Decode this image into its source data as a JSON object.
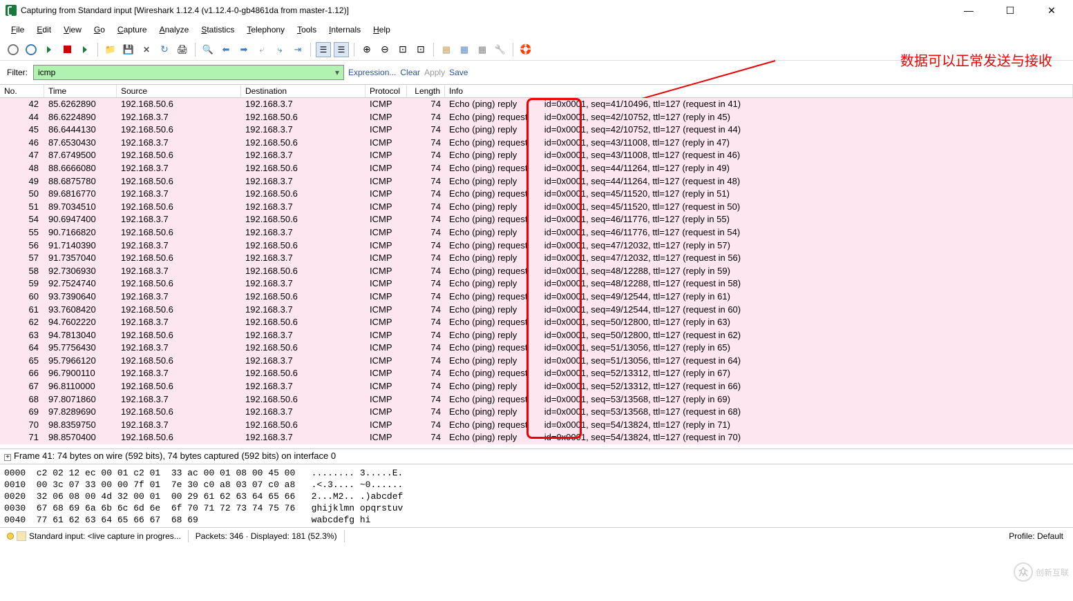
{
  "title": "Capturing from Standard input   [Wireshark 1.12.4  (v1.12.4-0-gb4861da from master-1.12)]",
  "menus": [
    "File",
    "Edit",
    "View",
    "Go",
    "Capture",
    "Analyze",
    "Statistics",
    "Telephony",
    "Tools",
    "Internals",
    "Help"
  ],
  "filter": {
    "label": "Filter:",
    "value": "icmp",
    "links": [
      "Expression...",
      "Clear",
      "Apply",
      "Save"
    ]
  },
  "columns": [
    "No.",
    "Time",
    "Source",
    "Destination",
    "Protocol",
    "Length",
    "Info"
  ],
  "packets": [
    {
      "no": 42,
      "time": "85.6262890",
      "src": "192.168.50.6",
      "dst": "192.168.3.7",
      "proto": "ICMP",
      "len": 74,
      "prefix": "Echo (ping)",
      "type": "reply",
      "rest": "id=0x0001, seq=41/10496, ttl=127 (request in 41)"
    },
    {
      "no": 44,
      "time": "86.6224890",
      "src": "192.168.3.7",
      "dst": "192.168.50.6",
      "proto": "ICMP",
      "len": 74,
      "prefix": "Echo (ping)",
      "type": "request",
      "rest": "id=0x0001, seq=42/10752, ttl=127 (reply in 45)"
    },
    {
      "no": 45,
      "time": "86.6444130",
      "src": "192.168.50.6",
      "dst": "192.168.3.7",
      "proto": "ICMP",
      "len": 74,
      "prefix": "Echo (ping)",
      "type": "reply",
      "rest": "id=0x0001, seq=42/10752, ttl=127 (request in 44)"
    },
    {
      "no": 46,
      "time": "87.6530430",
      "src": "192.168.3.7",
      "dst": "192.168.50.6",
      "proto": "ICMP",
      "len": 74,
      "prefix": "Echo (ping)",
      "type": "request",
      "rest": "id=0x0001, seq=43/11008, ttl=127 (reply in 47)"
    },
    {
      "no": 47,
      "time": "87.6749500",
      "src": "192.168.50.6",
      "dst": "192.168.3.7",
      "proto": "ICMP",
      "len": 74,
      "prefix": "Echo (ping)",
      "type": "reply",
      "rest": "id=0x0001, seq=43/11008, ttl=127 (request in 46)"
    },
    {
      "no": 48,
      "time": "88.6666080",
      "src": "192.168.3.7",
      "dst": "192.168.50.6",
      "proto": "ICMP",
      "len": 74,
      "prefix": "Echo (ping)",
      "type": "request",
      "rest": "id=0x0001, seq=44/11264, ttl=127 (reply in 49)"
    },
    {
      "no": 49,
      "time": "88.6875780",
      "src": "192.168.50.6",
      "dst": "192.168.3.7",
      "proto": "ICMP",
      "len": 74,
      "prefix": "Echo (ping)",
      "type": "reply",
      "rest": "id=0x0001, seq=44/11264, ttl=127 (request in 48)"
    },
    {
      "no": 50,
      "time": "89.6816770",
      "src": "192.168.3.7",
      "dst": "192.168.50.6",
      "proto": "ICMP",
      "len": 74,
      "prefix": "Echo (ping)",
      "type": "request",
      "rest": "id=0x0001, seq=45/11520, ttl=127 (reply in 51)"
    },
    {
      "no": 51,
      "time": "89.7034510",
      "src": "192.168.50.6",
      "dst": "192.168.3.7",
      "proto": "ICMP",
      "len": 74,
      "prefix": "Echo (ping)",
      "type": "reply",
      "rest": "id=0x0001, seq=45/11520, ttl=127 (request in 50)"
    },
    {
      "no": 54,
      "time": "90.6947400",
      "src": "192.168.3.7",
      "dst": "192.168.50.6",
      "proto": "ICMP",
      "len": 74,
      "prefix": "Echo (ping)",
      "type": "request",
      "rest": "id=0x0001, seq=46/11776, ttl=127 (reply in 55)"
    },
    {
      "no": 55,
      "time": "90.7166820",
      "src": "192.168.50.6",
      "dst": "192.168.3.7",
      "proto": "ICMP",
      "len": 74,
      "prefix": "Echo (ping)",
      "type": "reply",
      "rest": "id=0x0001, seq=46/11776, ttl=127 (request in 54)"
    },
    {
      "no": 56,
      "time": "91.7140390",
      "src": "192.168.3.7",
      "dst": "192.168.50.6",
      "proto": "ICMP",
      "len": 74,
      "prefix": "Echo (ping)",
      "type": "request",
      "rest": "id=0x0001, seq=47/12032, ttl=127 (reply in 57)"
    },
    {
      "no": 57,
      "time": "91.7357040",
      "src": "192.168.50.6",
      "dst": "192.168.3.7",
      "proto": "ICMP",
      "len": 74,
      "prefix": "Echo (ping)",
      "type": "reply",
      "rest": "id=0x0001, seq=47/12032, ttl=127 (request in 56)"
    },
    {
      "no": 58,
      "time": "92.7306930",
      "src": "192.168.3.7",
      "dst": "192.168.50.6",
      "proto": "ICMP",
      "len": 74,
      "prefix": "Echo (ping)",
      "type": "request",
      "rest": "id=0x0001, seq=48/12288, ttl=127 (reply in 59)"
    },
    {
      "no": 59,
      "time": "92.7524740",
      "src": "192.168.50.6",
      "dst": "192.168.3.7",
      "proto": "ICMP",
      "len": 74,
      "prefix": "Echo (ping)",
      "type": "reply",
      "rest": "id=0x0001, seq=48/12288, ttl=127 (request in 58)"
    },
    {
      "no": 60,
      "time": "93.7390640",
      "src": "192.168.3.7",
      "dst": "192.168.50.6",
      "proto": "ICMP",
      "len": 74,
      "prefix": "Echo (ping)",
      "type": "request",
      "rest": "id=0x0001, seq=49/12544, ttl=127 (reply in 61)"
    },
    {
      "no": 61,
      "time": "93.7608420",
      "src": "192.168.50.6",
      "dst": "192.168.3.7",
      "proto": "ICMP",
      "len": 74,
      "prefix": "Echo (ping)",
      "type": "reply",
      "rest": "id=0x0001, seq=49/12544, ttl=127 (request in 60)"
    },
    {
      "no": 62,
      "time": "94.7602220",
      "src": "192.168.3.7",
      "dst": "192.168.50.6",
      "proto": "ICMP",
      "len": 74,
      "prefix": "Echo (ping)",
      "type": "request",
      "rest": "id=0x0001, seq=50/12800, ttl=127 (reply in 63)"
    },
    {
      "no": 63,
      "time": "94.7813040",
      "src": "192.168.50.6",
      "dst": "192.168.3.7",
      "proto": "ICMP",
      "len": 74,
      "prefix": "Echo (ping)",
      "type": "reply",
      "rest": "id=0x0001, seq=50/12800, ttl=127 (request in 62)"
    },
    {
      "no": 64,
      "time": "95.7756430",
      "src": "192.168.3.7",
      "dst": "192.168.50.6",
      "proto": "ICMP",
      "len": 74,
      "prefix": "Echo (ping)",
      "type": "request",
      "rest": "id=0x0001, seq=51/13056, ttl=127 (reply in 65)"
    },
    {
      "no": 65,
      "time": "95.7966120",
      "src": "192.168.50.6",
      "dst": "192.168.3.7",
      "proto": "ICMP",
      "len": 74,
      "prefix": "Echo (ping)",
      "type": "reply",
      "rest": "id=0x0001, seq=51/13056, ttl=127 (request in 64)"
    },
    {
      "no": 66,
      "time": "96.7900110",
      "src": "192.168.3.7",
      "dst": "192.168.50.6",
      "proto": "ICMP",
      "len": 74,
      "prefix": "Echo (ping)",
      "type": "request",
      "rest": "id=0x0001, seq=52/13312, ttl=127 (reply in 67)"
    },
    {
      "no": 67,
      "time": "96.8110000",
      "src": "192.168.50.6",
      "dst": "192.168.3.7",
      "proto": "ICMP",
      "len": 74,
      "prefix": "Echo (ping)",
      "type": "reply",
      "rest": "id=0x0001, seq=52/13312, ttl=127 (request in 66)"
    },
    {
      "no": 68,
      "time": "97.8071860",
      "src": "192.168.3.7",
      "dst": "192.168.50.6",
      "proto": "ICMP",
      "len": 74,
      "prefix": "Echo (ping)",
      "type": "request",
      "rest": "id=0x0001, seq=53/13568, ttl=127 (reply in 69)"
    },
    {
      "no": 69,
      "time": "97.8289690",
      "src": "192.168.50.6",
      "dst": "192.168.3.7",
      "proto": "ICMP",
      "len": 74,
      "prefix": "Echo (ping)",
      "type": "reply",
      "rest": "id=0x0001, seq=53/13568, ttl=127 (request in 68)"
    },
    {
      "no": 70,
      "time": "98.8359750",
      "src": "192.168.3.7",
      "dst": "192.168.50.6",
      "proto": "ICMP",
      "len": 74,
      "prefix": "Echo (ping)",
      "type": "request",
      "rest": "id=0x0001, seq=54/13824, ttl=127 (reply in 71)"
    },
    {
      "no": 71,
      "time": "98.8570400",
      "src": "192.168.50.6",
      "dst": "192.168.3.7",
      "proto": "ICMP",
      "len": 74,
      "prefix": "Echo (ping)",
      "type": "reply",
      "rest": "id=0x0001, seq=54/13824, ttl=127 (request in 70)"
    }
  ],
  "annotation": "数据可以正常发送与接收",
  "detail_line": "Frame 41: 74 bytes on wire (592 bits), 74 bytes captured (592 bits) on interface 0",
  "hex": [
    "0000  c2 02 12 ec 00 01 c2 01  33 ac 00 01 08 00 45 00   ........ 3.....E.",
    "0010  00 3c 07 33 00 00 7f 01  7e 30 c0 a8 03 07 c0 a8   .<.3.... ~0......",
    "0020  32 06 08 00 4d 32 00 01  00 29 61 62 63 64 65 66   2...M2.. .)abcdef",
    "0030  67 68 69 6a 6b 6c 6d 6e  6f 70 71 72 73 74 75 76   ghijklmn opqrstuv",
    "0040  77 61 62 63 64 65 66 67  68 69                     wabcdefg hi"
  ],
  "status": {
    "capture": "Standard input: <live capture in progres...",
    "packets": "Packets: 346 · Displayed: 181 (52.3%)",
    "profile": "Profile: Default"
  },
  "watermark": "创新互联"
}
